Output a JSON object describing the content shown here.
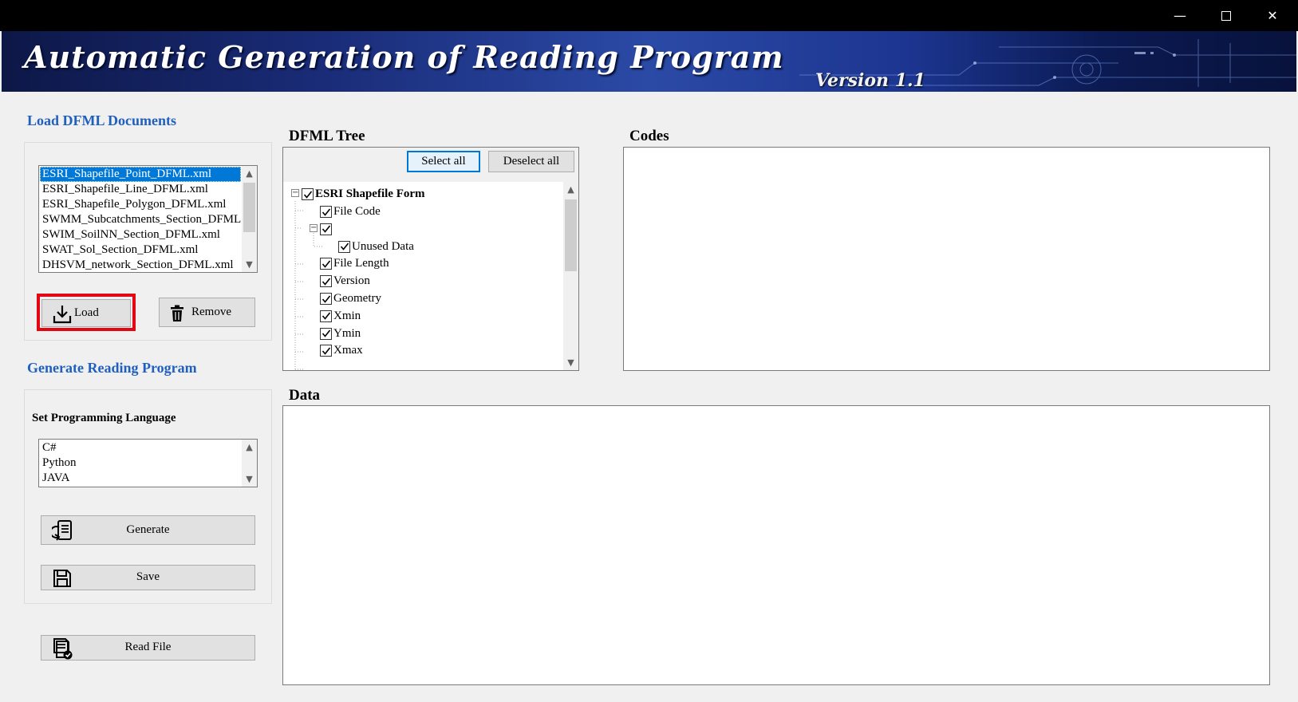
{
  "window": {
    "controls": {
      "minimize": "—",
      "close": "✕"
    }
  },
  "banner": {
    "title": "Automatic Generation of Reading Program",
    "version": "Version 1.1"
  },
  "load_section": {
    "title": "Load DFML Documents",
    "files": [
      "ESRI_Shapefile_Point_DFML.xml",
      "ESRI_Shapefile_Line_DFML.xml",
      "ESRI_Shapefile_Polygon_DFML.xml",
      "SWMM_Subcatchments_Section_DFML",
      "SWIM_SoilNN_Section_DFML.xml",
      "SWAT_Sol_Section_DFML.xml",
      "DHSVM_network_Section_DFML.xml"
    ],
    "selected_index": 0,
    "load_label": "Load",
    "remove_label": "Remove"
  },
  "generate_section": {
    "title": "Generate Reading Program",
    "language_label": "Set Programming Language",
    "languages": [
      "C#",
      "Python",
      "JAVA"
    ],
    "generate_label": "Generate",
    "save_label": "Save",
    "read_file_label": "Read File"
  },
  "tree_panel": {
    "label": "DFML Tree",
    "select_all_label": "Select all",
    "deselect_all_label": "Deselect all",
    "root": "ESRI Shapefile Form",
    "nodes": [
      {
        "label": "File Code",
        "level": 1,
        "checked": true
      },
      {
        "label": "",
        "level": 1,
        "checked": true,
        "expandable": true
      },
      {
        "label": "Unused Data",
        "level": 2,
        "checked": true
      },
      {
        "label": "File Length",
        "level": 1,
        "checked": true
      },
      {
        "label": "Version",
        "level": 1,
        "checked": true
      },
      {
        "label": "Geometry",
        "level": 1,
        "checked": true
      },
      {
        "label": "Xmin",
        "level": 1,
        "checked": true
      },
      {
        "label": "Ymin",
        "level": 1,
        "checked": true
      },
      {
        "label": "Xmax",
        "level": 1,
        "checked": true
      }
    ]
  },
  "codes_panel": {
    "label": "Codes",
    "content": ""
  },
  "data_panel": {
    "label": "Data",
    "content": ""
  },
  "colors": {
    "accent_blue": "#1f5fbf",
    "selection": "#0078d7",
    "highlight_red": "#e30613",
    "background": "#f0f0f0"
  }
}
